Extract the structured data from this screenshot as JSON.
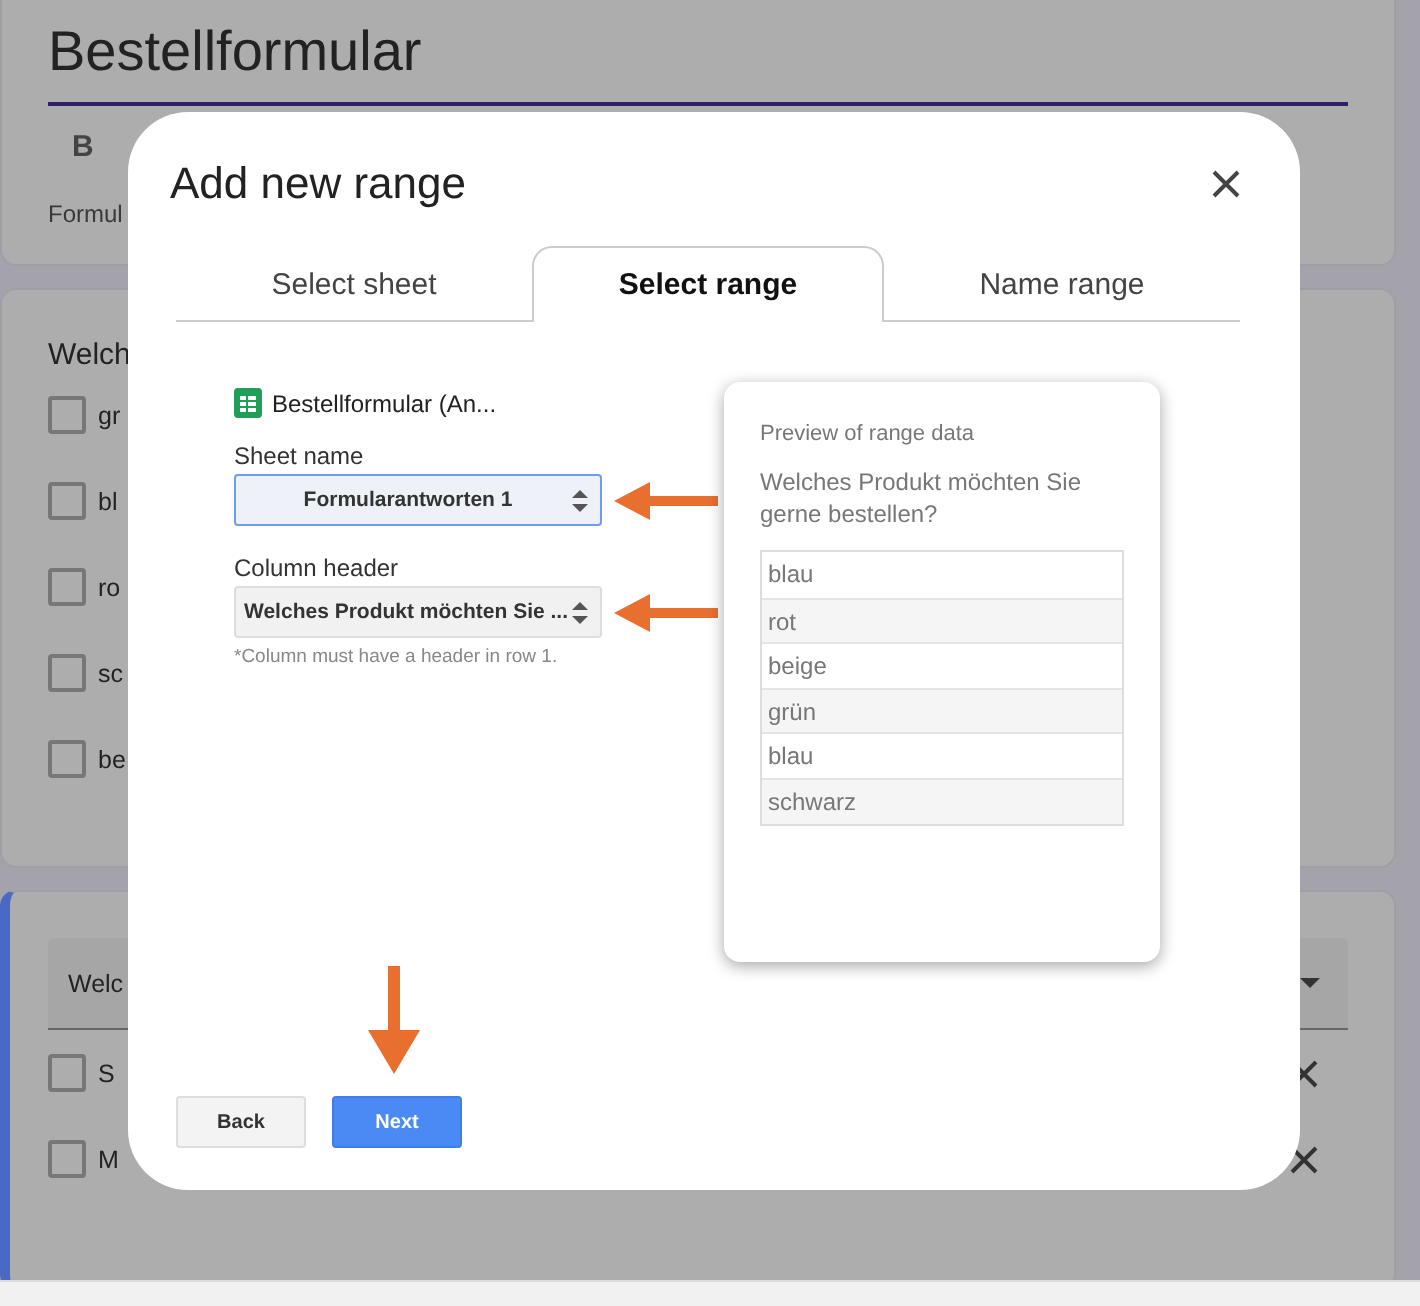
{
  "form": {
    "title": "Bestellformular",
    "toolbar_button": "B",
    "description": "Formul"
  },
  "question_1": {
    "title": "Welch",
    "options": [
      {
        "label": "gr",
        "checked": false
      },
      {
        "label": "bl",
        "checked": false
      },
      {
        "label": "ro",
        "checked": false
      },
      {
        "label": "sc",
        "checked": false
      },
      {
        "label": "be",
        "checked": false
      }
    ]
  },
  "question_2": {
    "active": true,
    "field_value": "Welc",
    "options": [
      {
        "label": "S",
        "checked": false
      },
      {
        "label": "M",
        "checked": false
      }
    ]
  },
  "dialog": {
    "title": "Add new range",
    "tabs": [
      {
        "label": "Select sheet",
        "selected": false
      },
      {
        "label": "Select range",
        "selected": true
      },
      {
        "label": "Name range",
        "selected": false
      }
    ],
    "spreadsheet": "Bestellformular (An...",
    "sheet_name": {
      "label": "Sheet name",
      "value": "Formularantworten 1",
      "focused": true
    },
    "column_header": {
      "label": "Column header",
      "value": "Welches Produkt möchten Sie ...",
      "focused": false
    },
    "note": "*Column must have a header in row 1.",
    "preview": {
      "title": "Preview of range data",
      "header": "Welches Produkt möchten Sie gerne bestellen?",
      "rows": [
        "blau",
        "rot",
        "beige",
        "grün",
        "blau",
        "schwarz"
      ]
    },
    "buttons": [
      {
        "label": "Back",
        "kind": "secondary"
      },
      {
        "label": "Next",
        "kind": "primary"
      }
    ]
  }
}
